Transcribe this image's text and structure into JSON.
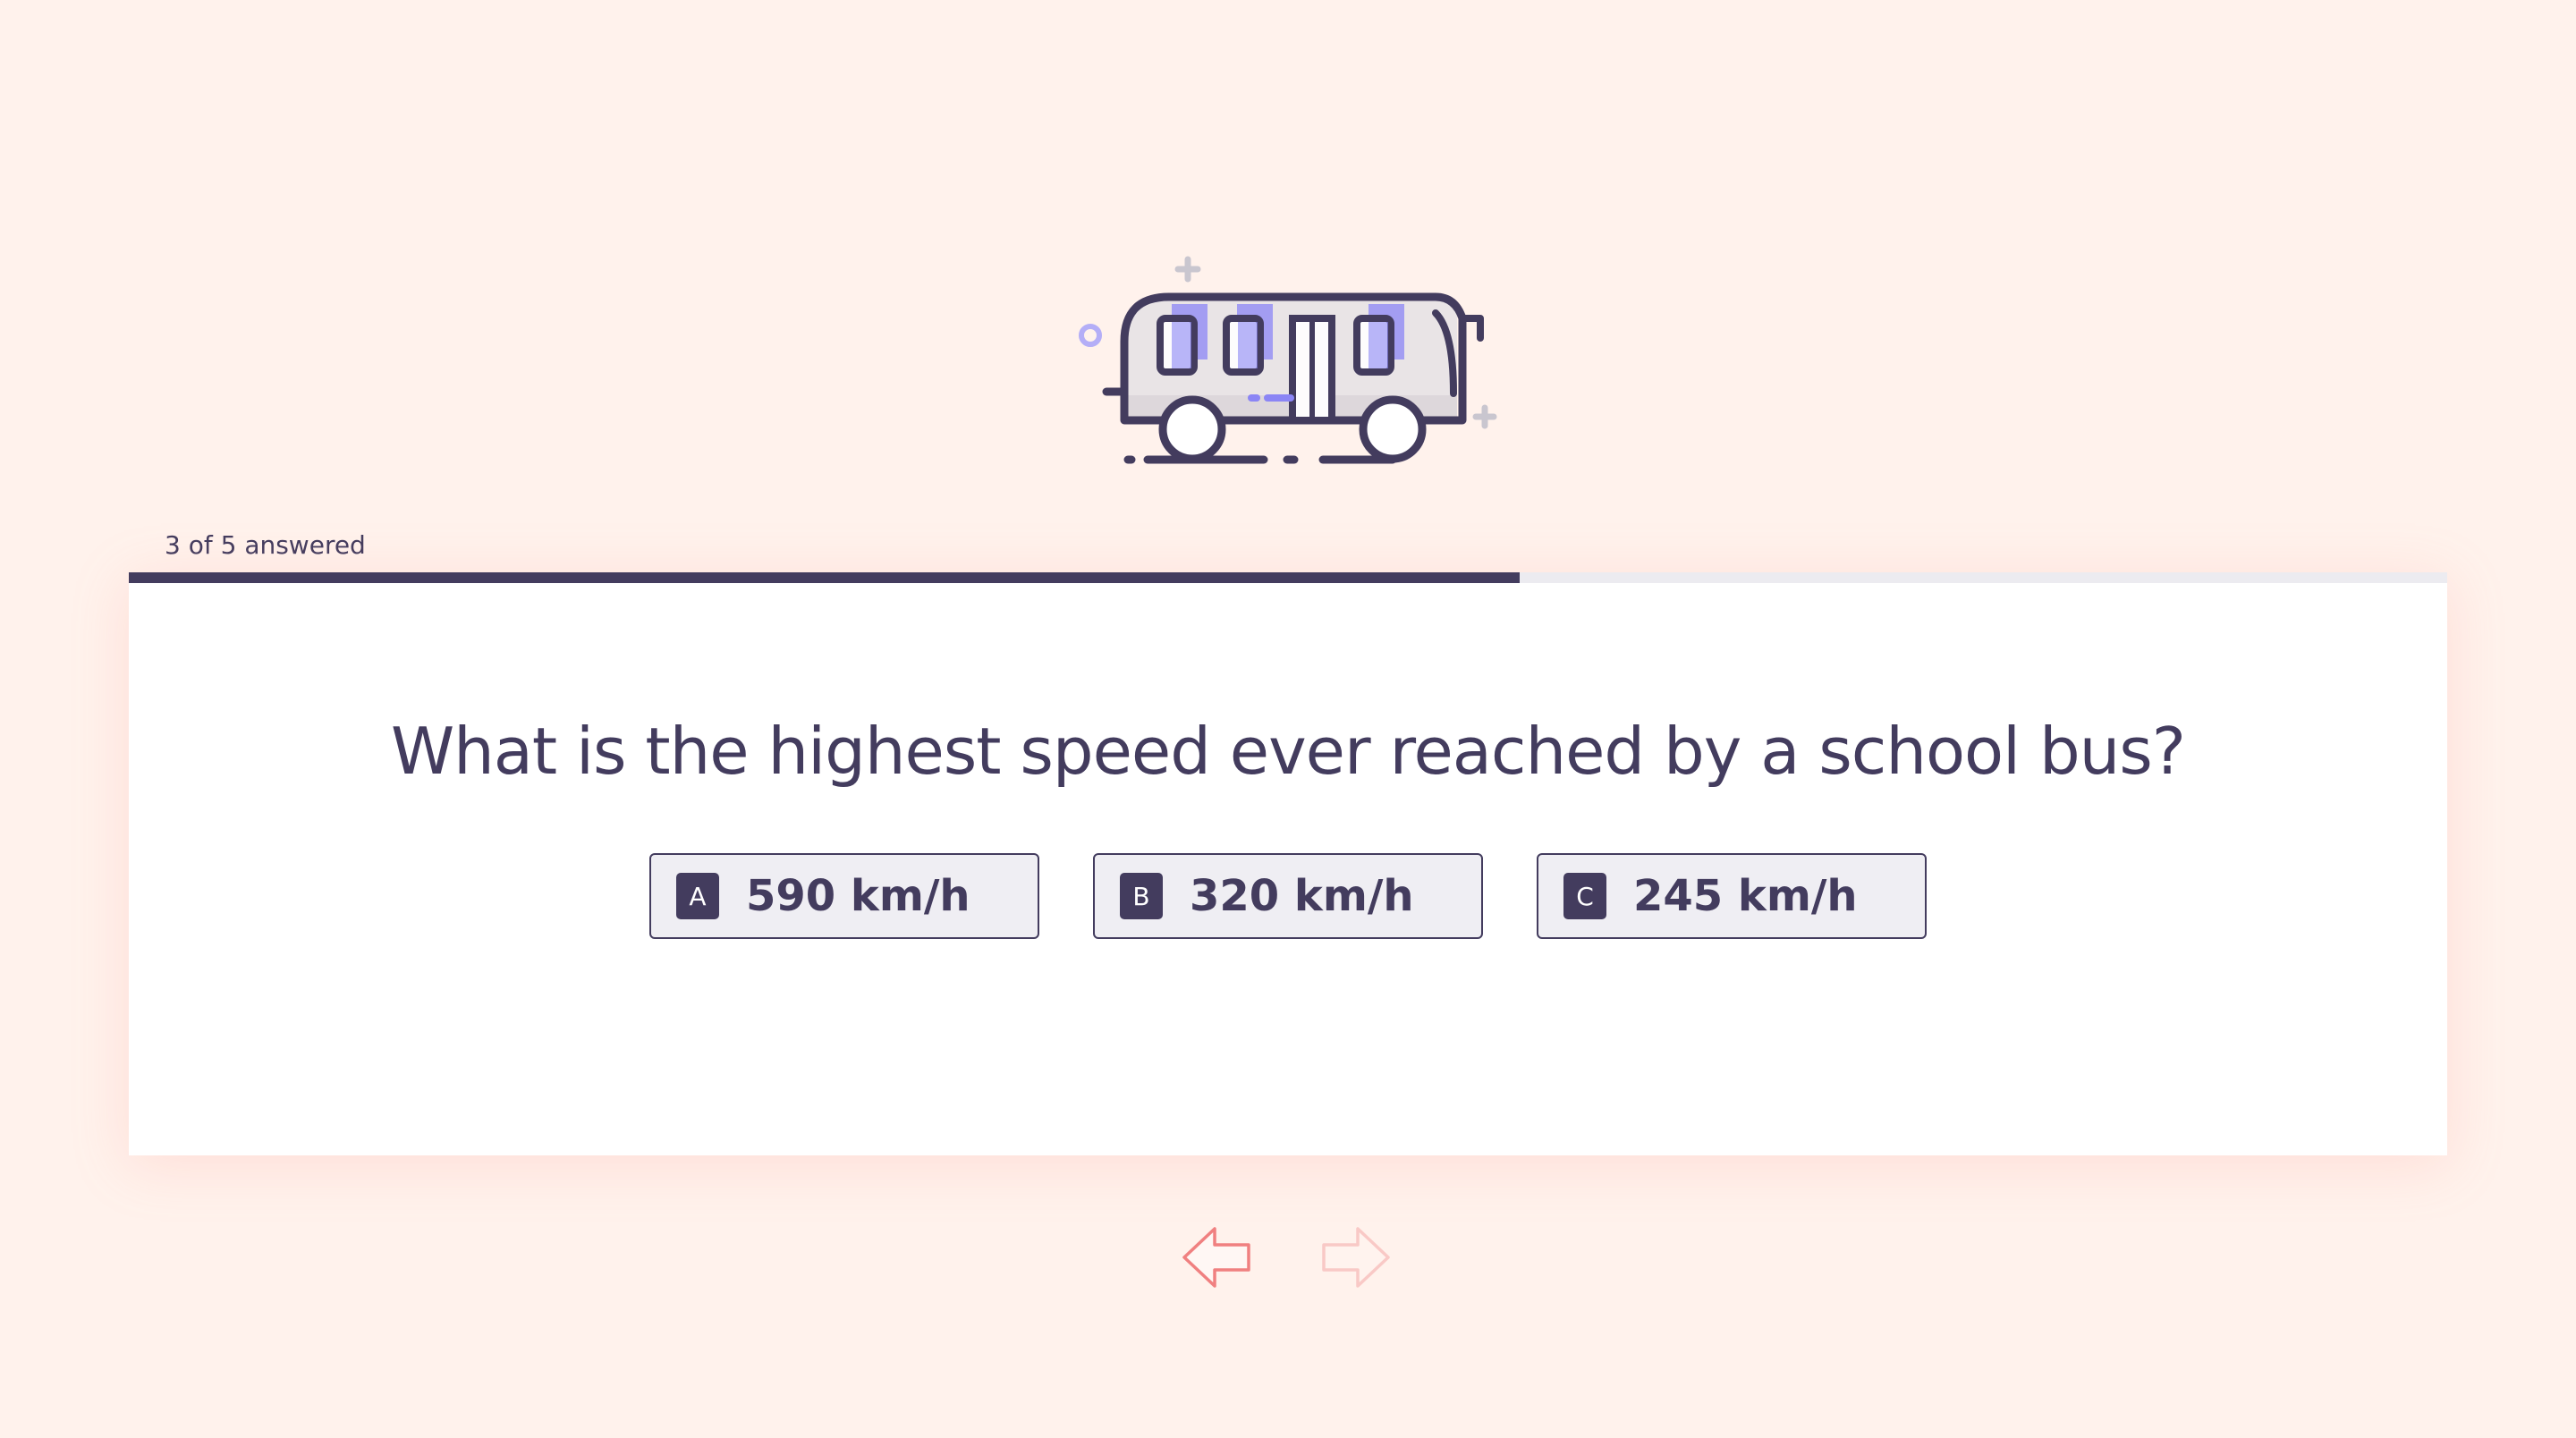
{
  "progress": {
    "text": "3 of 5 answered",
    "answered": 3,
    "total": 5,
    "fraction": 0.6
  },
  "question": {
    "text": "What is the highest speed ever reached by a school bus?"
  },
  "options": [
    {
      "key": "A",
      "label": "590 km/h"
    },
    {
      "key": "B",
      "label": "320 km/h"
    },
    {
      "key": "C",
      "label": "245 km/h"
    }
  ],
  "illustration": {
    "icon": "school-bus-icon"
  },
  "navigation": {
    "prev_icon": "arrow-left-icon",
    "next_icon": "arrow-right-icon",
    "next_enabled": false
  },
  "colors": {
    "background": "#fff2ec",
    "primary": "#433c5e",
    "accent": "#8b85f5",
    "card": "#ffffff",
    "option_fill": "#efeef3",
    "arrow": "#f08080"
  }
}
